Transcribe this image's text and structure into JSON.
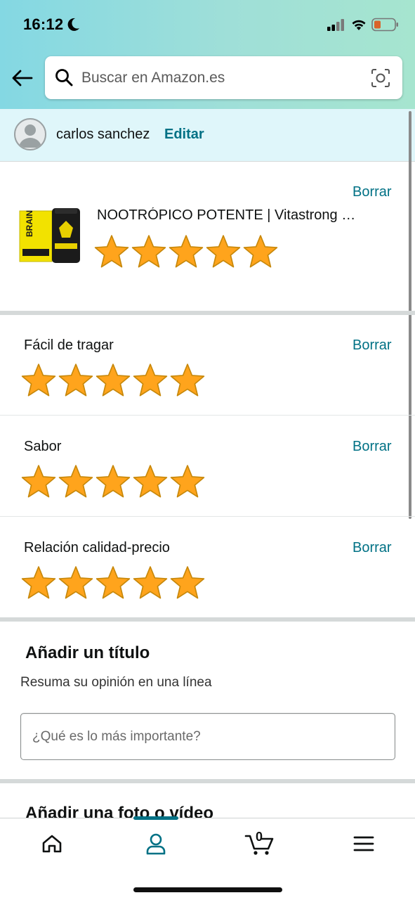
{
  "status_bar": {
    "time": "16:12"
  },
  "search": {
    "placeholder": "Buscar en Amazon.es"
  },
  "user": {
    "name": "carlos sanchez",
    "edit_label": "Editar"
  },
  "product": {
    "title": "NOOTRÓPICO POTENTE | Vitastrong …",
    "delete_label": "Borrar",
    "rating": 5,
    "max_rating": 5,
    "image_text": "BRAIN BOOSTER"
  },
  "ratings": [
    {
      "label": "Fácil de tragar",
      "delete_label": "Borrar",
      "rating": 5
    },
    {
      "label": "Sabor",
      "delete_label": "Borrar",
      "rating": 5
    },
    {
      "label": "Relación calidad-precio",
      "delete_label": "Borrar",
      "rating": 5
    }
  ],
  "title_section": {
    "heading": "Añadir un título",
    "subtitle": "Resuma su opinión en una línea",
    "placeholder": "¿Qué es lo más importante?"
  },
  "photo_section": {
    "heading": "Añadir una foto o vídeo"
  },
  "bottom_nav": {
    "items": [
      "home-icon",
      "account-icon",
      "cart-icon",
      "menu-icon"
    ],
    "active": "account-icon",
    "cart_count": "0"
  },
  "colors": {
    "link": "#007185",
    "star": "#ffa41c",
    "accent": "#007185"
  }
}
